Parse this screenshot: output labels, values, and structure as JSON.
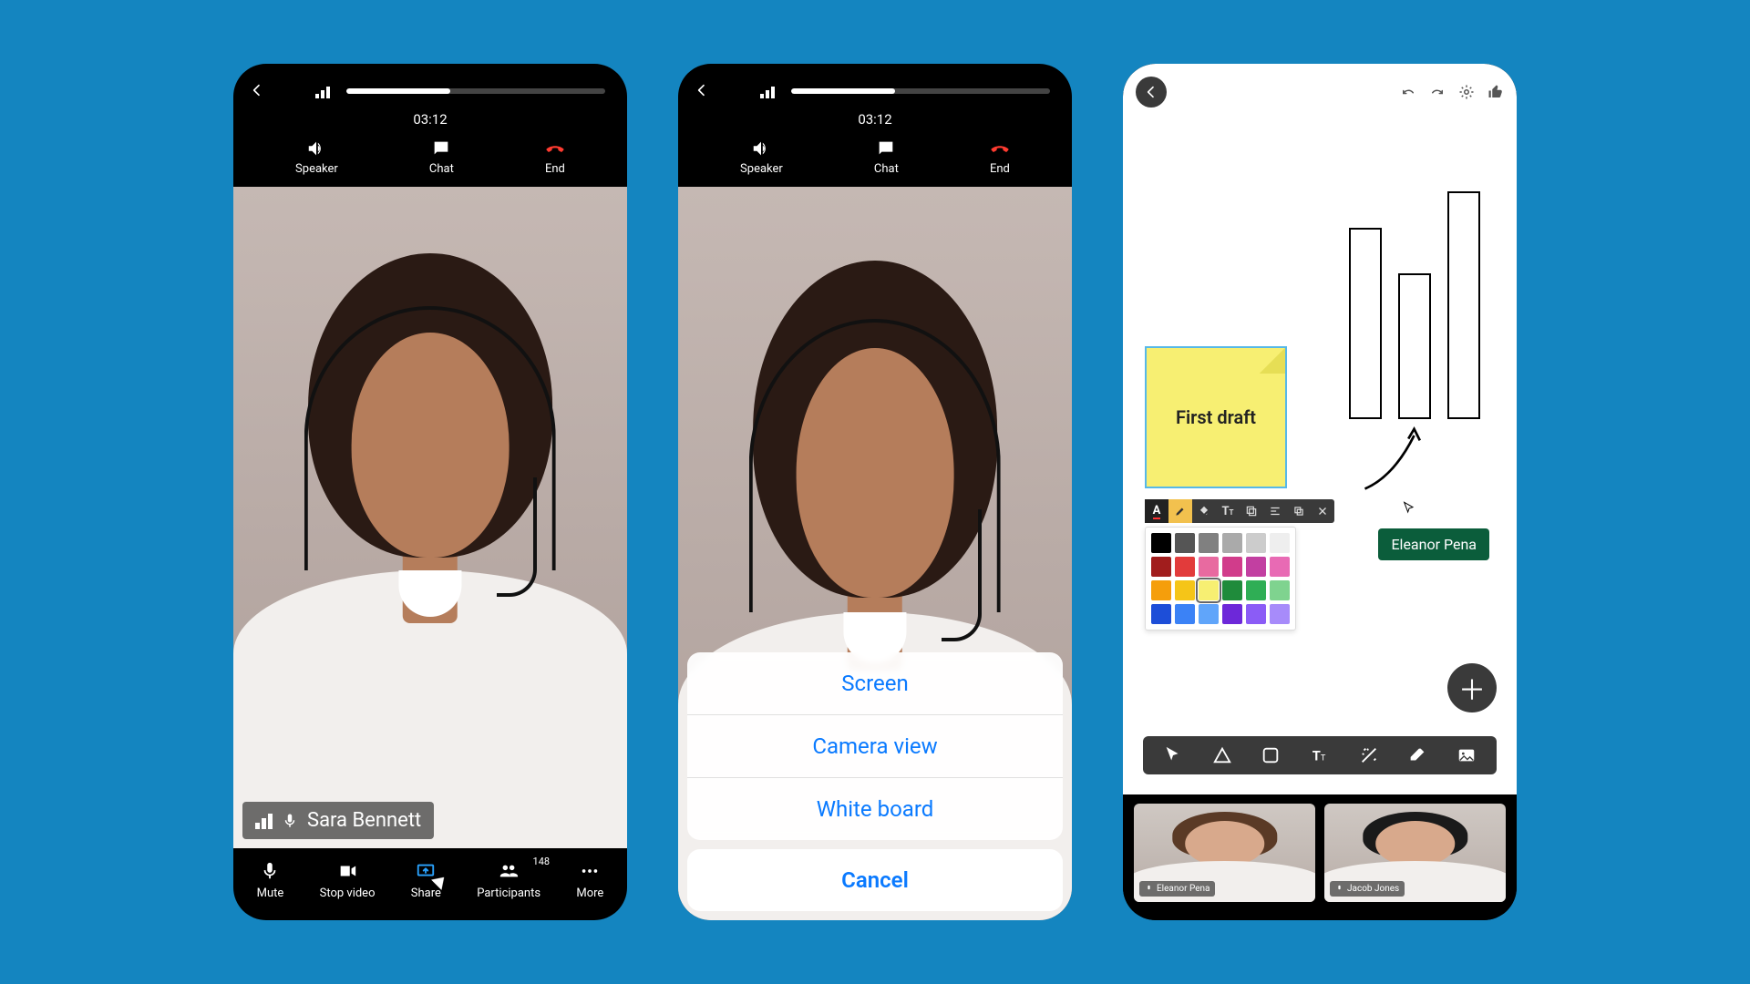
{
  "call": {
    "timer": "03:12",
    "speaker": "Speaker",
    "chat": "Chat",
    "end": "End",
    "participant_name": "Sara Bennett"
  },
  "bottom": {
    "mute": "Mute",
    "stop_video": "Stop video",
    "share": "Share",
    "participants": "Participants",
    "participants_count": "148",
    "more": "More"
  },
  "share_sheet": {
    "screen": "Screen",
    "camera": "Camera view",
    "whiteboard": "White board",
    "cancel": "Cancel"
  },
  "whiteboard": {
    "sticky_text": "First draft",
    "remote_user": "Eleanor Pena",
    "thumb1_name": "Eleanor Pena",
    "thumb2_name": "Jacob Jones"
  },
  "swatch_colors": [
    "#000000",
    "#555555",
    "#808080",
    "#aaaaaa",
    "#cccccc",
    "#eeeeee",
    "#a11d1d",
    "#e23b3b",
    "#e86aa0",
    "#d13c8b",
    "#c23fa1",
    "#e86ab4",
    "#f59e0b",
    "#f5c518",
    "#f7ef72",
    "#1f8b3b",
    "#2fae55",
    "#7fd38f",
    "#1d4ed8",
    "#3b82f6",
    "#60a5fa",
    "#6d28d9",
    "#8b5cf6",
    "#a78bfa"
  ]
}
